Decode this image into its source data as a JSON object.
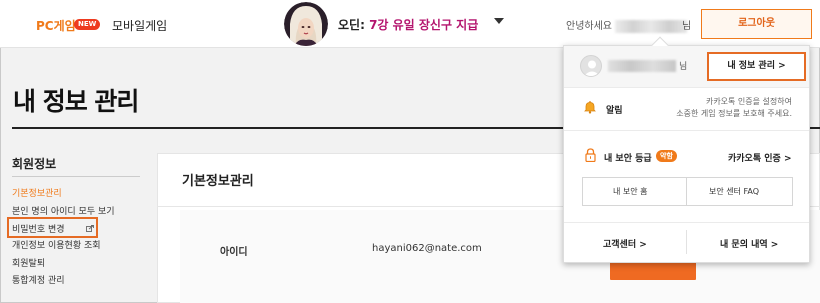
{
  "header": {
    "nav_pc": "PC게임",
    "new_badge": "NEW",
    "nav_mobile": "모바일게임",
    "promo_prefix": "오딘: ",
    "promo_accent": "7강 유일 장신구 지급",
    "greeting": "안녕하세요",
    "name_suffix": "님",
    "logout_label": "로그아웃"
  },
  "page": {
    "title": "내 정보 관리"
  },
  "sidebar": {
    "heading": "회원정보",
    "items": [
      {
        "label": "기본정보관리"
      },
      {
        "label": "본인 명의 아이디 모두 보기"
      },
      {
        "label": "비밀번호 변경"
      },
      {
        "label": "개인정보 이용현황 조회"
      },
      {
        "label": "회원탈퇴"
      },
      {
        "label": "통합계정 관리"
      }
    ]
  },
  "content": {
    "title": "기본정보관리",
    "id_label": "아이디",
    "id_value": "hayani062@nate.com"
  },
  "dropdown": {
    "name_suffix": "님",
    "my_info_button": "내 정보 관리 >",
    "alarm_label": "알림",
    "alarm_desc_line1": "카카오톡 인증을 설정하여",
    "alarm_desc_line2": "소중한 게임 정보를 보호해 주세요.",
    "security_label": "내 보안 등급",
    "security_badge": "약함",
    "kakao_auth": "카카오톡 인증 >",
    "security_home": "내 보안 홈",
    "security_faq": "보안 센터 FAQ",
    "customer_center": "고객센터 >",
    "inquiry_history": "내 문의 내역 >"
  },
  "colors": {
    "accent": "#f07a1a",
    "highlight": "#e56b24",
    "promo_accent": "#b4156e",
    "new_badge": "#ee3a1f"
  }
}
